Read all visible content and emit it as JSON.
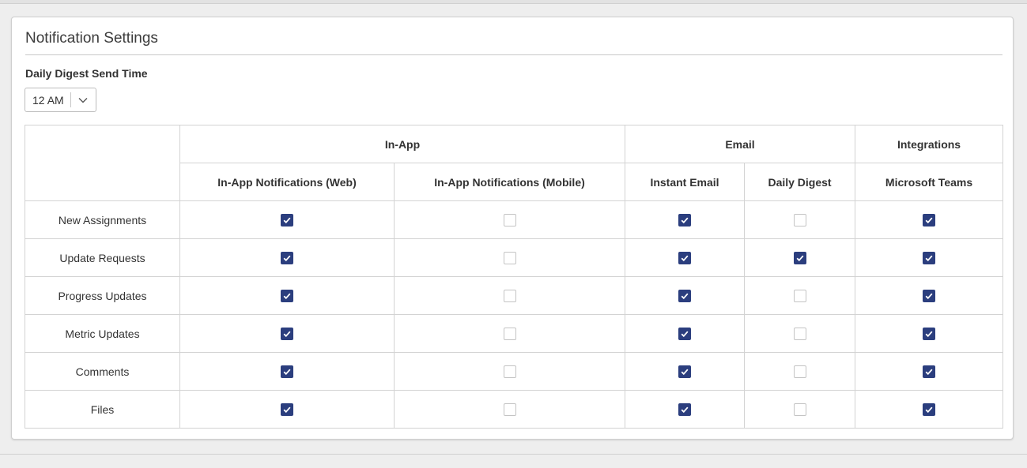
{
  "card": {
    "title": "Notification Settings"
  },
  "digest": {
    "label": "Daily Digest Send Time",
    "value": "12 AM",
    "chevron_icon": "chevron-down-icon"
  },
  "table": {
    "groups": [
      {
        "label": "In-App",
        "span": 2
      },
      {
        "label": "Email",
        "span": 2
      },
      {
        "label": "Integrations",
        "span": 1
      }
    ],
    "columns": [
      "In-App Notifications (Web)",
      "In-App Notifications (Mobile)",
      "Instant Email",
      "Daily Digest",
      "Microsoft Teams"
    ],
    "rows": [
      {
        "label": "New Assignments",
        "checks": [
          true,
          false,
          true,
          false,
          true
        ]
      },
      {
        "label": "Update Requests",
        "checks": [
          true,
          false,
          true,
          true,
          true
        ]
      },
      {
        "label": "Progress Updates",
        "checks": [
          true,
          false,
          true,
          false,
          true
        ]
      },
      {
        "label": "Metric Updates",
        "checks": [
          true,
          false,
          true,
          false,
          true
        ]
      },
      {
        "label": "Comments",
        "checks": [
          true,
          false,
          true,
          false,
          true
        ]
      },
      {
        "label": "Files",
        "checks": [
          true,
          false,
          true,
          false,
          true
        ]
      }
    ]
  },
  "colors": {
    "checked": "#2b3e7e",
    "unchecked_border": "#c4c4c4",
    "grid_border": "#d3d3d3"
  }
}
